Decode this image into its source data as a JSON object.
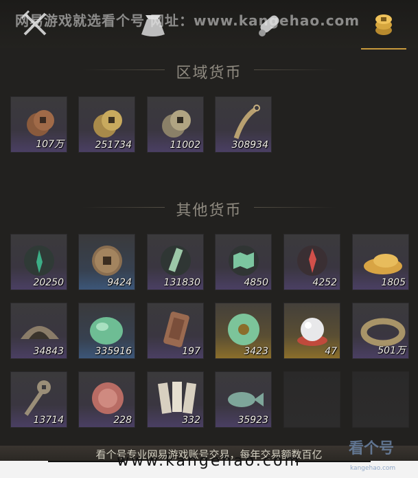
{
  "watermark": {
    "top_text": "网易游戏就选看个号  网址：www.kangehao.com"
  },
  "tabs": [
    {
      "icon": "crossed-swords-icon"
    },
    {
      "icon": "pouch-icon"
    },
    {
      "icon": "scroll-icon"
    },
    {
      "icon": "coin-stack-icon",
      "active": true
    }
  ],
  "regional": {
    "title": "区域货币",
    "items": [
      {
        "icon": "bronze-coins-icon",
        "qty": "107万"
      },
      {
        "icon": "gold-coins-icon",
        "qty": "251734"
      },
      {
        "icon": "silver-coins-icon",
        "qty": "11002"
      },
      {
        "icon": "coin-string-icon",
        "qty": "308934"
      }
    ]
  },
  "other": {
    "title": "其他货币",
    "items": [
      {
        "icon": "green-emblem-icon",
        "qty": "20250"
      },
      {
        "icon": "ancient-coin-icon",
        "qty": "9424"
      },
      {
        "icon": "green-token-icon",
        "qty": "131830"
      },
      {
        "icon": "green-map-icon",
        "qty": "4850"
      },
      {
        "icon": "red-emblem-icon",
        "qty": "4252"
      },
      {
        "icon": "gold-powder-icon",
        "qty": "1805"
      },
      {
        "icon": "half-coin-icon",
        "qty": "34843"
      },
      {
        "icon": "jade-stone-icon",
        "qty": "335916"
      },
      {
        "icon": "copper-plaque-icon",
        "qty": "197"
      },
      {
        "icon": "jade-disc-icon",
        "qty": "3423"
      },
      {
        "icon": "pearl-icon",
        "qty": "47"
      },
      {
        "icon": "coin-ring-icon",
        "qty": "501万"
      },
      {
        "icon": "key-coin-icon",
        "qty": "13714"
      },
      {
        "icon": "red-jade-icon",
        "qty": "228"
      },
      {
        "icon": "paper-slips-icon",
        "qty": "332"
      },
      {
        "icon": "jade-fish-icon",
        "qty": "35923"
      }
    ]
  },
  "footer": {
    "notice": "看个号专业网易游戏账号交易，每年交易额数百亿",
    "url": "www.kangehao.com",
    "logo": "看个号",
    "logo_sub": "kangehao.com"
  },
  "colors": {
    "accent": "#c89a3c",
    "slot_purple": "#4a3f63",
    "slot_gold": "#8b6e2b",
    "slot_blue": "#3c5678"
  }
}
